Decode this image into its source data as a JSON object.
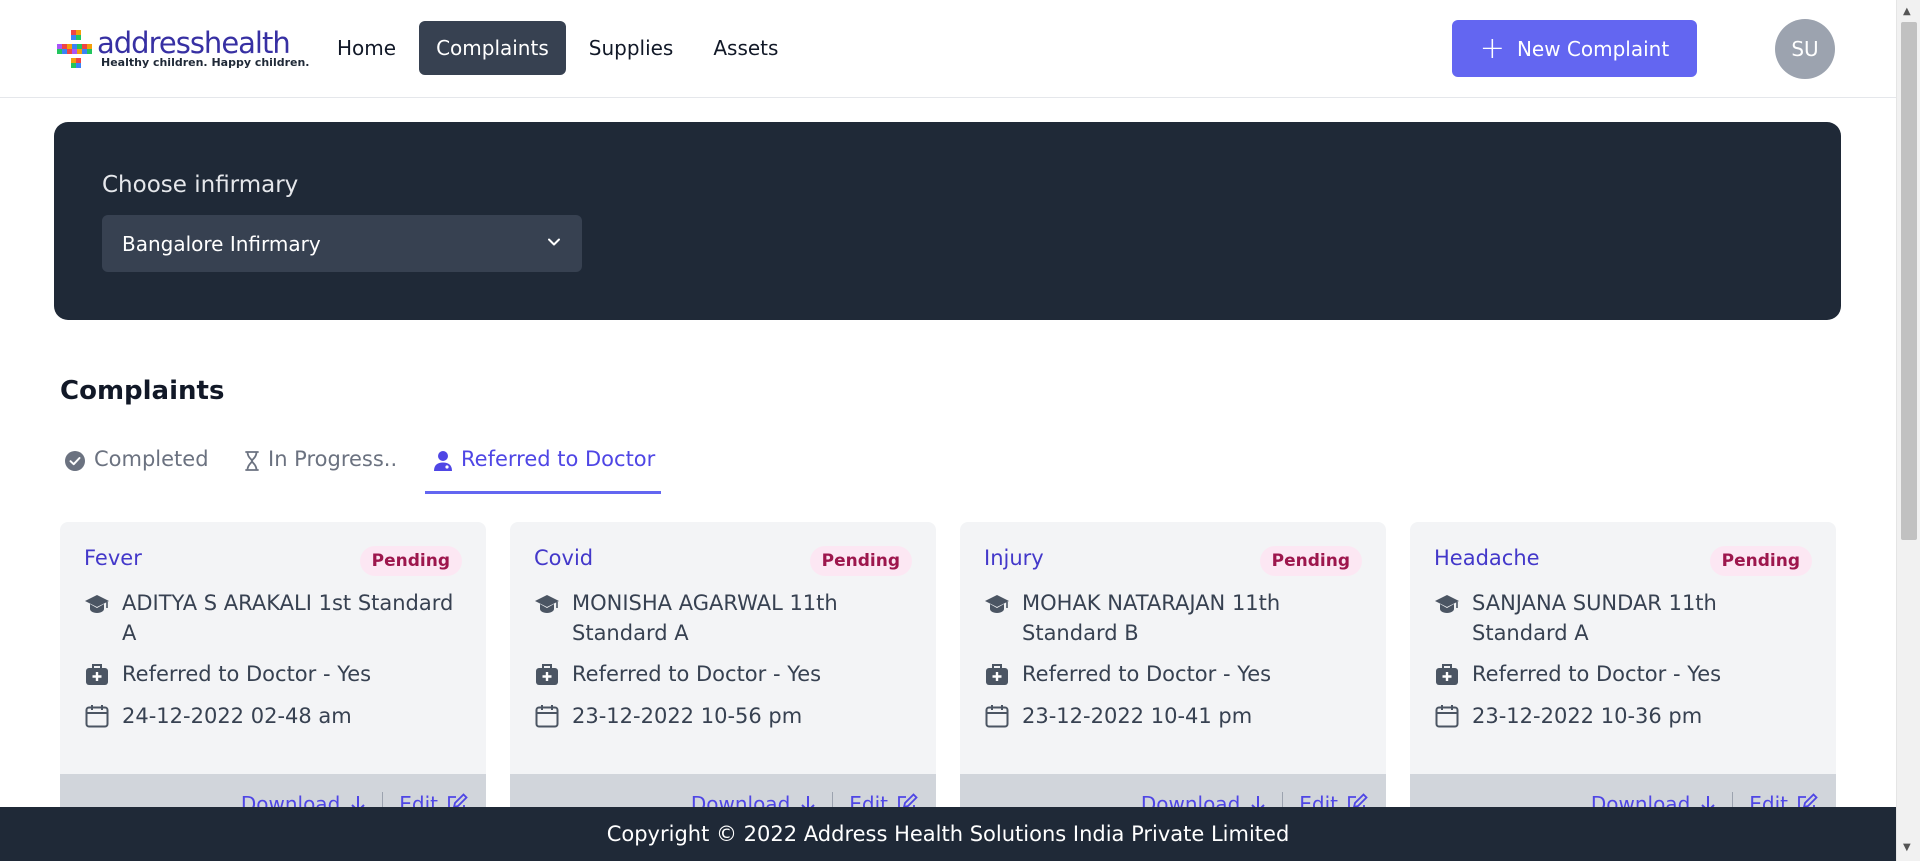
{
  "header": {
    "logo_text": "addresshealth",
    "logo_tagline": "Healthy children. Happy children.",
    "nav": [
      {
        "label": "Home"
      },
      {
        "label": "Complaints"
      },
      {
        "label": "Supplies"
      },
      {
        "label": "Assets"
      }
    ],
    "active_nav": "Complaints",
    "new_complaint_label": "New Complaint",
    "avatar_initials": "SU"
  },
  "infirmary": {
    "label": "Choose infirmary",
    "selected": "Bangalore Infirmary"
  },
  "complaints": {
    "heading": "Complaints",
    "tabs": [
      {
        "label": "Completed"
      },
      {
        "label": "In Progress.."
      },
      {
        "label": "Referred to Doctor"
      }
    ],
    "active_tab": "Referred to Doctor",
    "cards": [
      {
        "title": "Fever",
        "status": "Pending",
        "student": "ADITYA S ARAKALI 1st Standard A",
        "referral": "Referred to Doctor - Yes",
        "datetime": "24-12-2022 02-48 am",
        "download": "Download",
        "edit": "Edit"
      },
      {
        "title": "Covid",
        "status": "Pending",
        "student": "MONISHA AGARWAL 11th Standard A",
        "referral": "Referred to Doctor - Yes",
        "datetime": "23-12-2022 10-56 pm",
        "download": "Download",
        "edit": "Edit"
      },
      {
        "title": "Injury",
        "status": "Pending",
        "student": "MOHAK NATARAJAN 11th Standard B",
        "referral": "Referred to Doctor - Yes",
        "datetime": "23-12-2022 10-41 pm",
        "download": "Download",
        "edit": "Edit"
      },
      {
        "title": "Headache",
        "status": "Pending",
        "student": "SANJANA SUNDAR 11th Standard A",
        "referral": "Referred to Doctor - Yes",
        "datetime": "23-12-2022 10-36 pm",
        "download": "Download",
        "edit": "Edit"
      }
    ]
  },
  "footer": {
    "copyright": "Copyright © 2022 Address Health Solutions India Private Limited"
  },
  "colors": {
    "accent": "#6366f1",
    "dark_panel": "#1f2937",
    "pending_bg": "#fce7f3",
    "pending_text": "#9d174d"
  }
}
